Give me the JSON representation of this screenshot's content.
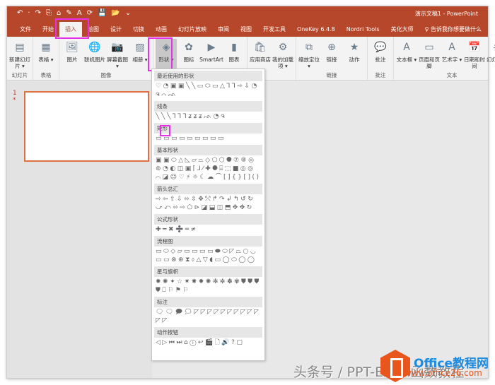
{
  "window": {
    "title": "演示文稿1 - PowerPoint"
  },
  "qat": [
    "↶",
    "·",
    "↷",
    "⎘",
    "⌂",
    "✎",
    "A",
    "⟳",
    "💾",
    "📂",
    "⌄"
  ],
  "tabs": [
    "文件",
    "开始",
    "插入",
    "绘图",
    "设计",
    "切换",
    "动画",
    "幻灯片放映",
    "审阅",
    "视图",
    "开发工具",
    "OneKey 6.4.8",
    "Nordri Tools",
    "美化大师",
    "♀ 告诉我你想要做什么"
  ],
  "active_tab": "插入",
  "ribbon": {
    "groups": [
      {
        "label": "幻灯片",
        "buttons": [
          {
            "label": "新建幻灯片 ▾",
            "icon": "▤"
          }
        ]
      },
      {
        "label": "表格",
        "buttons": [
          {
            "label": "表格 ▾",
            "icon": "▦"
          }
        ]
      },
      {
        "label": "图像",
        "buttons": [
          {
            "label": "图片",
            "icon": "🖼"
          },
          {
            "label": "联机图片",
            "icon": "🌐"
          },
          {
            "label": "屏幕截图 ▾",
            "icon": "📷"
          },
          {
            "label": "相册 ▾",
            "icon": "▨"
          }
        ]
      },
      {
        "label": "",
        "buttons": [
          {
            "label": "形状 ▾",
            "icon": "◈"
          },
          {
            "label": "图标",
            "icon": "✿"
          },
          {
            "label": "SmartArt",
            "icon": "▶"
          },
          {
            "label": "图表",
            "icon": "▮"
          }
        ]
      },
      {
        "label": "",
        "buttons": [
          {
            "label": "应用商店",
            "icon": "🛍"
          },
          {
            "label": "我的加载项 ▾",
            "icon": "⚙"
          }
        ]
      },
      {
        "label": "链接",
        "buttons": [
          {
            "label": "缩放定位 ▾",
            "icon": "⧉"
          },
          {
            "label": "链接",
            "icon": "⊕"
          },
          {
            "label": "动作",
            "icon": "★"
          }
        ]
      },
      {
        "label": "批注",
        "buttons": [
          {
            "label": "批注",
            "icon": "💬"
          }
        ]
      },
      {
        "label": "文本",
        "buttons": [
          {
            "label": "文本框 ▾",
            "icon": "A"
          },
          {
            "label": "页眉和页脚",
            "icon": "▭"
          },
          {
            "label": "艺术字 ▾",
            "icon": "A"
          },
          {
            "label": "日期和时间",
            "icon": "📅"
          },
          {
            "label": "幻灯片编号",
            "icon": "#"
          }
        ]
      }
    ]
  },
  "slides": [
    {
      "number": "1",
      "marker": "*"
    }
  ],
  "shapes_menu": {
    "sections": [
      {
        "title": "最近使用的形状",
        "shapes": "♡◔▣▣╲╲▭⬭▭△⅂⅂⇨⇩◔ຈ⌒ᨒ"
      },
      {
        "title": "线条",
        "shapes": "╲╲╲⅂⅂⅂ʑʑʑᨒ◔ຈ"
      },
      {
        "title": "矩形",
        "shapes": "▭▭▭▭▭▭▭▭▭"
      },
      {
        "title": "基本形状",
        "shapes": "▣▣⬭△◺▱⏢◇⬠⬡⯃⑦⑧◎⊚◔◐◫▣⌈⅃⁄✚⯃⌸⬚■◎◎⌒◪☺♡⚡☼☾☁⌒[]{}[]()"
      },
      {
        "title": "箭头总汇",
        "shapes": "⇨⇦⇧⇩⬄⇳✥⤲↱↷↲↰↺↻⤻⤺⬄⇨⬠⊳◪⬓◫⬒✥✥↻"
      },
      {
        "title": "公式形状",
        "shapes": "✚━✖➗═≠"
      },
      {
        "title": "流程图",
        "shapes": "▭⬭◇▱▭▭▭▭⬬⬭◸⏢○◡▭▭⊗⊕⧗⬨△▽◖▭◯⬭◯◯"
      },
      {
        "title": "星与旗帜",
        "shapes": "✹✺✦☆✷✸✹✺✻✼✽✾⛊⛊⛊⛊⎕⚐⚑⚐"
      },
      {
        "title": "标注",
        "shapes": "🗨🗨🗩🗯◸◸◸◸◸◸◸◸◸◸◸◸"
      },
      {
        "title": "动作按钮",
        "shapes": "◁▷⏮⏭⌂ⓘ↩🎬🗋🔊?▢"
      }
    ]
  },
  "watermark": {
    "text": "头条号 / PPT-Excel函数教程",
    "brand": "Office教程网",
    "url": "www.office26.com"
  }
}
